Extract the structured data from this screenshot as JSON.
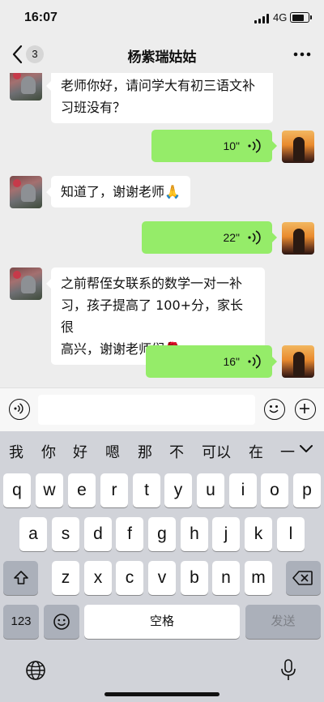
{
  "status_bar": {
    "time": "16:07",
    "network": "4G"
  },
  "header": {
    "back_badge": "3",
    "title": "杨紫瑞姑姑"
  },
  "messages": [
    {
      "side": "in",
      "text_lines": [
        "老师你好，请问学大有初三语文补",
        "习班没有？"
      ]
    },
    {
      "side": "out",
      "type": "voice",
      "duration": "10\""
    },
    {
      "side": "in",
      "text_lines": [
        "知道了，谢谢老师🙏"
      ]
    },
    {
      "side": "out",
      "type": "voice",
      "duration": "22\""
    },
    {
      "side": "in",
      "text_lines": [
        "之前帮侄女联系的数学一对一补",
        "习，孩子提高了 100+分，家长很",
        "高兴，谢谢老师们🌹"
      ]
    },
    {
      "side": "out",
      "type": "voice",
      "duration": "16\""
    }
  ],
  "keyboard": {
    "candidates": [
      "我",
      "你",
      "好",
      "嗯",
      "那",
      "不",
      "可以",
      "在",
      "一"
    ],
    "row1": [
      "q",
      "w",
      "e",
      "r",
      "t",
      "y",
      "u",
      "i",
      "o",
      "p"
    ],
    "row2": [
      "a",
      "s",
      "d",
      "f",
      "g",
      "h",
      "j",
      "k",
      "l"
    ],
    "row3": [
      "z",
      "x",
      "c",
      "v",
      "b",
      "n",
      "m"
    ],
    "numbers_key": "123",
    "space_key": "空格",
    "send_key": "发送"
  },
  "colors": {
    "outgoing_bubble": "#95ec69",
    "chat_background": "#ededed",
    "keyboard_background": "#d1d3d9"
  }
}
